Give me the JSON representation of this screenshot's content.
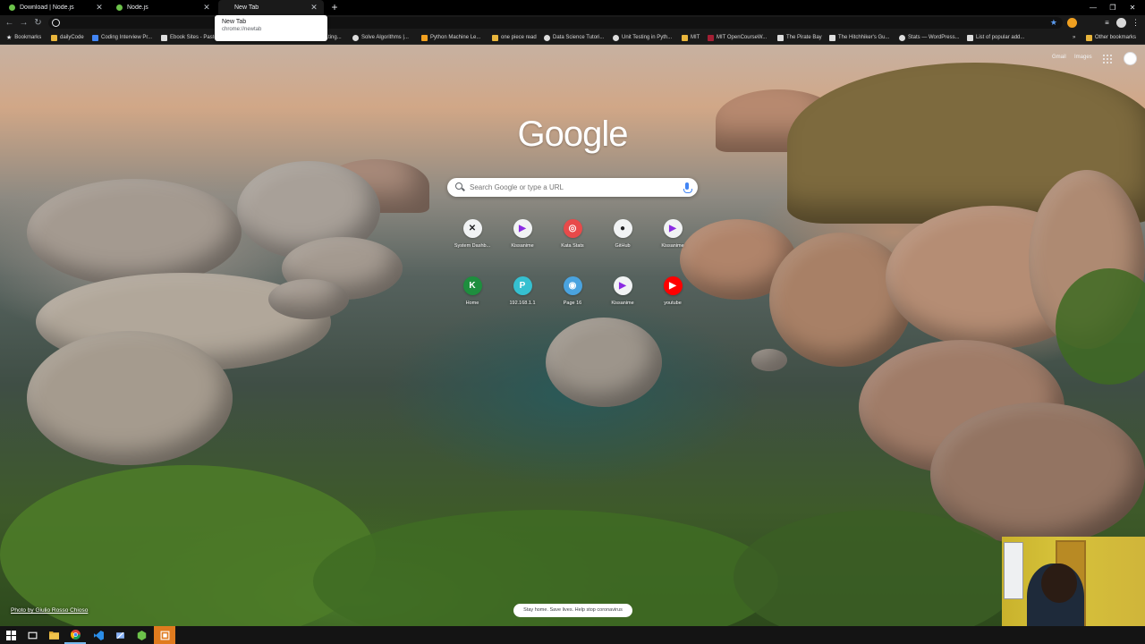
{
  "tabs": [
    {
      "title": "Download | Node.js",
      "icon": "nodejs-icon",
      "active": false
    },
    {
      "title": "Node.js",
      "icon": "nodejs-icon",
      "active": false
    },
    {
      "title": "New Tab",
      "icon": "none",
      "active": true
    }
  ],
  "tab_tooltip": {
    "title": "New Tab",
    "url": "chrome://newtab"
  },
  "address_bar": {
    "value": ""
  },
  "bookmarks": [
    {
      "label": "Bookmarks",
      "icon": "star-icon"
    },
    {
      "label": "dailyCode",
      "icon": "folder-icon"
    },
    {
      "label": "Coding Interview Pr...",
      "icon": "page-icon"
    },
    {
      "label": "Ebook Sites - Paste",
      "icon": "page-icon"
    },
    {
      "label": "...ting...",
      "icon": "page-icon"
    },
    {
      "label": "Solve Algorithms |...",
      "icon": "globe-icon"
    },
    {
      "label": "Python Machine Le...",
      "icon": "page-icon"
    },
    {
      "label": "one piece read",
      "icon": "folder-icon"
    },
    {
      "label": "Data Science Tutori...",
      "icon": "globe-icon"
    },
    {
      "label": "Unit Testing in Pyth...",
      "icon": "globe-icon"
    },
    {
      "label": "MIT",
      "icon": "folder-icon"
    },
    {
      "label": "MIT OpenCourseW...",
      "icon": "page-icon"
    },
    {
      "label": "The Pirate Bay",
      "icon": "page-icon"
    },
    {
      "label": "The Hitchhiker's Gu...",
      "icon": "page-icon"
    },
    {
      "label": "Stats — WordPress...",
      "icon": "globe-icon"
    },
    {
      "label": "List of popular add...",
      "icon": "page-icon"
    }
  ],
  "bookmarks_more": "»",
  "other_bookmarks": "Other bookmarks",
  "ntp": {
    "gmail": "Gmail",
    "images": "Images",
    "logo": "Google",
    "search_placeholder": "Search Google or type a URL",
    "shortcuts": [
      {
        "label": "System Dashb...",
        "icon": "system-icon",
        "color": "#ffffff",
        "glyph": "✕"
      },
      {
        "label": "Kissanime",
        "icon": "play-icon",
        "color": "#ffffff",
        "glyph": "▶"
      },
      {
        "label": "Kata Stats",
        "icon": "codewars-icon",
        "color": "#e84a4a",
        "glyph": "◎"
      },
      {
        "label": "GitHub",
        "icon": "github-icon",
        "color": "#ffffff",
        "glyph": "●"
      },
      {
        "label": "Kissanime",
        "icon": "play-icon",
        "color": "#ffffff",
        "glyph": "▶"
      },
      {
        "label": "Home",
        "icon": "letter-k-icon",
        "color": "#1e8e3e",
        "glyph": "K"
      },
      {
        "label": "192.168.1.1",
        "icon": "router-icon",
        "color": "#35c0d0",
        "glyph": "P"
      },
      {
        "label": "Page 16",
        "icon": "globe-icon",
        "color": "#4aa3df",
        "glyph": "◉"
      },
      {
        "label": "Kissanime",
        "icon": "play-icon",
        "color": "#ffffff",
        "glyph": "▶"
      },
      {
        "label": "youtube",
        "icon": "youtube-icon",
        "color": "#ff0000",
        "glyph": "▶"
      }
    ],
    "attribution": "Photo by Giulio Rosso Chioso",
    "promo": "Stay home. Save lives. Help stop coronavirus"
  },
  "colors": {
    "accent": "#5c9cf0",
    "taskbar_active": "#76b9ed"
  }
}
